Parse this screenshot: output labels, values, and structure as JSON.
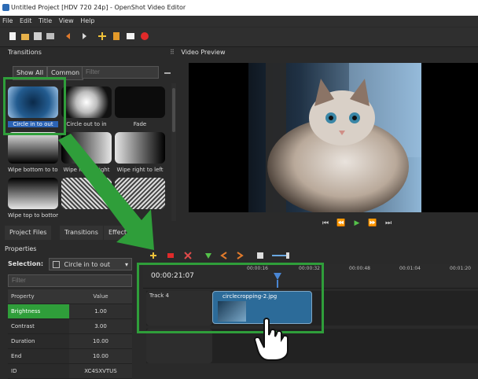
{
  "window": {
    "title": "Untitled Project [HDV 720 24p] - OpenShot Video Editor"
  },
  "menu": [
    "File",
    "Edit",
    "Title",
    "View",
    "Help"
  ],
  "transitions": {
    "header": "Transitions",
    "show_all": "Show All",
    "common": "Common",
    "filter_placeholder": "Filter",
    "items": [
      {
        "label": "Circle in to out"
      },
      {
        "label": "Circle out to in"
      },
      {
        "label": "Fade"
      },
      {
        "label": "Wipe bottom to top"
      },
      {
        "label": "Wipe left to right"
      },
      {
        "label": "Wipe right to left"
      },
      {
        "label": "Wipe top to bottom"
      },
      {
        "label": ""
      },
      {
        "label": ""
      }
    ]
  },
  "preview": {
    "header": "Video Preview"
  },
  "tabs": [
    "Project Files",
    "Transitions",
    "Effects"
  ],
  "properties": {
    "header": "Properties",
    "selection_label": "Selection:",
    "selection_value": "Circle in to out",
    "filter_placeholder": "Filter",
    "columns": [
      "Property",
      "Value"
    ],
    "rows": [
      {
        "k": "Brightness",
        "v": "1.00"
      },
      {
        "k": "Contrast",
        "v": "3.00"
      },
      {
        "k": "Duration",
        "v": "10.00"
      },
      {
        "k": "End",
        "v": "10.00"
      },
      {
        "k": "ID",
        "v": "XC4SXVTUS"
      }
    ]
  },
  "timeline": {
    "timecode": "00:00:21:07",
    "ticks": [
      "00:00:16",
      "00:00:32",
      "00:00:48",
      "00:01:04",
      "00:01:20"
    ],
    "track1_label": "Track 4",
    "clip_name": "circlecropping-2.jpg"
  },
  "colors": {
    "accent_green": "#2f9e3a",
    "clip_blue": "#2c6b99"
  }
}
